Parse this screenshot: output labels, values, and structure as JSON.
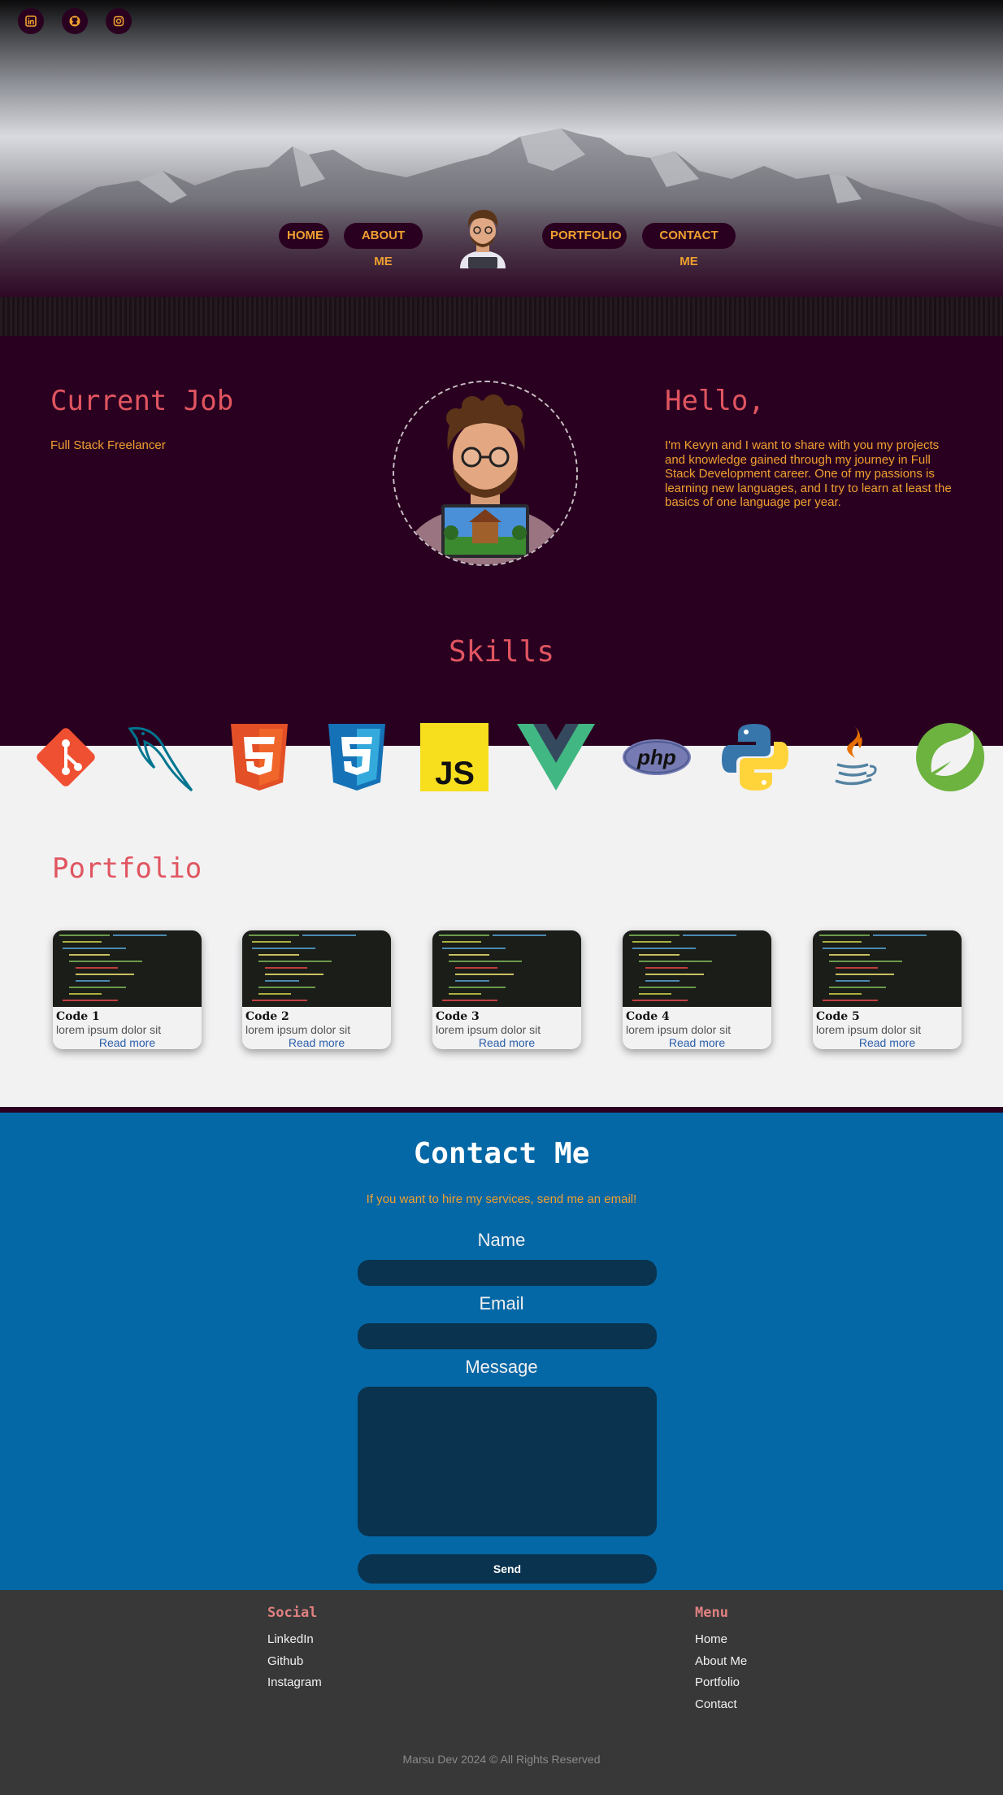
{
  "social_top": [
    {
      "icon": "linkedin-icon"
    },
    {
      "icon": "github-icon"
    },
    {
      "icon": "instagram-icon"
    }
  ],
  "nav": {
    "home": "HOME",
    "about": "ABOUT ME",
    "portfolio": "PORTFOLIO",
    "contact": "CONTACT ME"
  },
  "about": {
    "job_title": "Current Job",
    "job_text": "Full Stack Freelancer",
    "hello_title": "Hello,",
    "hello_text": "I'm Kevyn and I want to share with you my projects and knowledge gained through my journey in Full Stack Development career. One of my passions is learning new languages, and I try to learn at least the basics of one language per year."
  },
  "skills": {
    "title": "Skills",
    "items": [
      "git-icon",
      "mysql-icon",
      "html5-icon",
      "css3-icon",
      "javascript-icon",
      "vue-icon",
      "php-icon",
      "python-icon",
      "java-icon",
      "spring-icon"
    ],
    "js_text": "JS",
    "php_text": "php"
  },
  "portfolio": {
    "title": "Portfolio",
    "cards": [
      {
        "name": "Code 1",
        "desc": "lorem ipsum dolor sit",
        "link": "Read more"
      },
      {
        "name": "Code 2",
        "desc": "lorem ipsum dolor sit",
        "link": "Read more"
      },
      {
        "name": "Code 3",
        "desc": "lorem ipsum dolor sit",
        "link": "Read more"
      },
      {
        "name": "Code 4",
        "desc": "lorem ipsum dolor sit",
        "link": "Read more"
      },
      {
        "name": "Code 5",
        "desc": "lorem ipsum dolor sit",
        "link": "Read more"
      }
    ]
  },
  "contact": {
    "title": "Contact Me",
    "subtitle": "If you want to hire my services, send me an email!",
    "name_label": "Name",
    "email_label": "Email",
    "message_label": "Message",
    "name_value": "",
    "email_value": "",
    "message_value": "",
    "send_label": "Send"
  },
  "footer": {
    "social_title": "Social",
    "social_links": [
      "LinkedIn",
      "Github",
      "Instagram"
    ],
    "menu_title": "Menu",
    "menu_links": [
      "Home",
      "About Me",
      "Portfolio",
      "Contact"
    ],
    "copyright": "Marsu Dev 2024 © All Rights Reserved"
  },
  "colors": {
    "accent": "#f0a030",
    "heading": "#e05560",
    "dark_bg": "#2a0020",
    "contact_bg": "#0568a6",
    "footer_bg": "#383838"
  }
}
